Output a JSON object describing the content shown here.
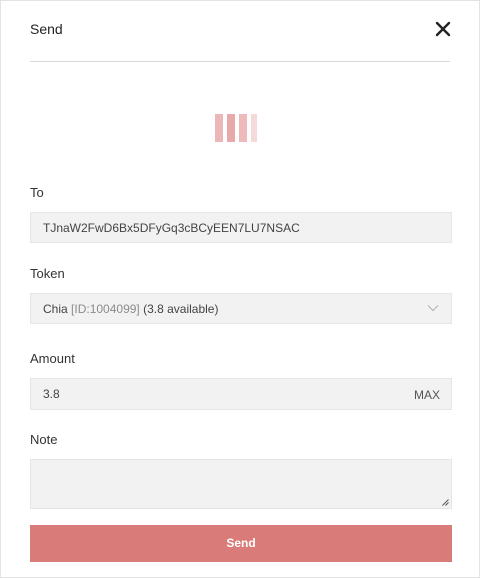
{
  "dialog": {
    "title": "Send",
    "close_icon": "close-icon"
  },
  "loader": {
    "icon": "loading-bars-icon",
    "colors": [
      "#ebb7b7",
      "#e7a9a9",
      "#eeb9b9",
      "#f5dada"
    ]
  },
  "form": {
    "to_label": "To",
    "to_value": "TJnaW2FwD6Bx5DFyGq3cBCyEEN7LU7NSAC",
    "token_label": "Token",
    "token_name": "Chia",
    "token_id": "[ID:1004099]",
    "token_available": "(3.8 available)",
    "token_chevron_icon": "chevron-down-icon",
    "amount_label": "Amount",
    "amount_value": "3.8",
    "max_label": "MAX",
    "note_label": "Note",
    "note_value": ""
  },
  "send_button": {
    "label": "Send",
    "color": "#d97b78"
  }
}
